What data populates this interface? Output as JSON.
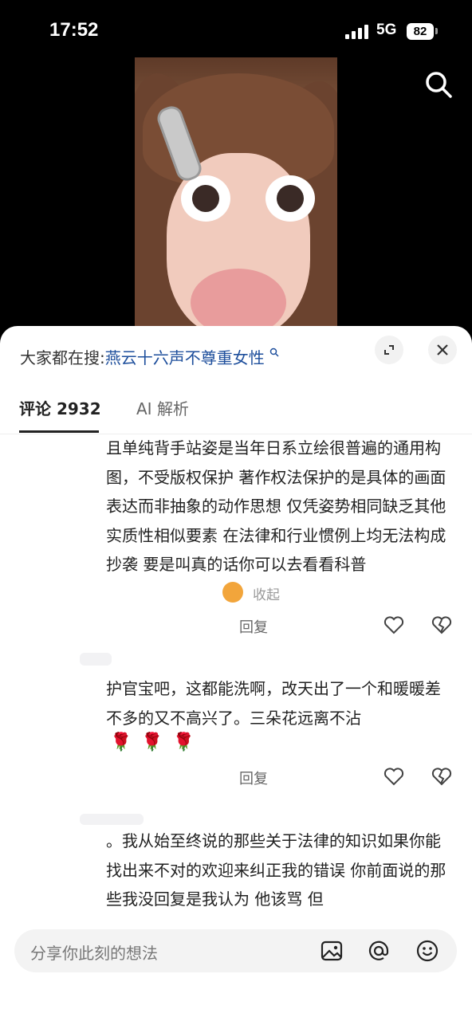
{
  "status": {
    "time": "17:52",
    "network": "5G",
    "battery": "82"
  },
  "search_banner": {
    "prefix": "大家都在搜:",
    "term": "燕云十六声不尊重女性"
  },
  "tabs": [
    {
      "label": "评论 2932",
      "active": true
    },
    {
      "label": "AI 解析",
      "active": false
    }
  ],
  "comments": [
    {
      "text": "且单纯背手站姿是当年日系立绘很普遍的通用构图，不受版权保护 著作权法保护的是具体的画面表达而非抽象的动作思想 仅凭姿势相同缺乏其他实质性相似要素 在法律和行业惯例上均无法构成抄袭 要是叫真的话你可以去看看科普",
      "collapse_label": "收起",
      "reply_label": "回复"
    },
    {
      "text": "护官宝吧，这都能洗啊，改天出了一个和暖暖差不多的又不高兴了。三朵花远离不沾",
      "emoji": "🌹🌹🌹",
      "reply_label": "回复"
    },
    {
      "text": "。我从始至终说的那些关于法律的知识如果你能找出来不对的欢迎来纠正我的错误 你前面说的那些我没回复是我认为 他该骂 但"
    }
  ],
  "input": {
    "placeholder": "分享你此刻的想法"
  },
  "icons": [
    "search-icon",
    "expand-icon",
    "close-icon",
    "like-icon",
    "dislike-icon",
    "image-icon",
    "at-icon",
    "emoji-icon"
  ]
}
